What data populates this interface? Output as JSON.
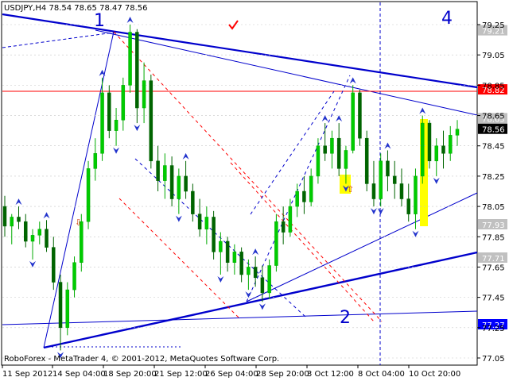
{
  "chart_data": {
    "type": "candlestick",
    "title": "USDJPY,H4  78.54 78.65 78.47 78.56",
    "footer": "RoboForex - MetaTrader 4, © 2001-2012, MetaQuotes Software Corp.",
    "y_ticks": [
      "79.25",
      "79.05",
      "78.85",
      "78.65",
      "78.45",
      "78.25",
      "78.05",
      "77.85",
      "77.65",
      "77.45",
      "77.25",
      "77.05"
    ],
    "x_ticks": [
      "11 Sep 2012",
      "14 Sep 04:00",
      "18 Sep 20:00",
      "21 Sep 12:00",
      "26 Sep 04:00",
      "28 Sep 20:00",
      "3 Oct 12:00",
      "8 Oct 04:00",
      "10 Oct 20:00"
    ],
    "ylim": [
      77.0,
      79.3
    ],
    "price_labels": [
      {
        "value": 79.21,
        "text": "79.21",
        "color": "#c0c0c0"
      },
      {
        "value": 78.82,
        "text": "78.82",
        "color": "#ff0000"
      },
      {
        "value": 78.63,
        "text": "78.63",
        "color": "#c0c0c0"
      },
      {
        "value": 78.56,
        "text": "78.56",
        "color": "#000000"
      },
      {
        "value": 77.93,
        "text": "77.93",
        "color": "#c0c0c0"
      },
      {
        "value": 77.71,
        "text": "77.71",
        "color": "#c0c0c0"
      },
      {
        "value": 77.27,
        "text": "77.27",
        "color": "#0000ff"
      }
    ],
    "wave_labels": [
      "1",
      "2",
      "4"
    ],
    "candles": [
      [
        78.05,
        78.12,
        77.85,
        77.92
      ],
      [
        77.92,
        78.0,
        77.8,
        77.98
      ],
      [
        77.98,
        78.05,
        77.9,
        77.95
      ],
      [
        77.95,
        78.0,
        77.78,
        77.82
      ],
      [
        77.82,
        77.9,
        77.7,
        77.86
      ],
      [
        77.86,
        77.95,
        77.8,
        77.9
      ],
      [
        77.9,
        77.96,
        77.75,
        77.78
      ],
      [
        77.78,
        77.85,
        77.5,
        77.55
      ],
      [
        77.55,
        77.6,
        77.1,
        77.25
      ],
      [
        77.25,
        77.55,
        77.2,
        77.5
      ],
      [
        77.5,
        77.72,
        77.45,
        77.68
      ],
      [
        77.68,
        78.0,
        77.62,
        77.95
      ],
      [
        77.95,
        78.35,
        77.9,
        78.3
      ],
      [
        78.3,
        78.5,
        78.22,
        78.4
      ],
      [
        78.4,
        78.9,
        78.35,
        78.8
      ],
      [
        78.8,
        78.85,
        78.5,
        78.55
      ],
      [
        78.55,
        78.7,
        78.45,
        78.62
      ],
      [
        78.62,
        78.9,
        78.55,
        78.85
      ],
      [
        78.85,
        79.25,
        78.8,
        79.2
      ],
      [
        79.2,
        79.22,
        78.6,
        78.7
      ],
      [
        78.7,
        79.0,
        78.6,
        78.88
      ],
      [
        78.88,
        78.92,
        78.3,
        78.35
      ],
      [
        78.35,
        78.45,
        78.15,
        78.22
      ],
      [
        78.22,
        78.4,
        78.1,
        78.32
      ],
      [
        78.32,
        78.38,
        78.05,
        78.1
      ],
      [
        78.1,
        78.3,
        78.0,
        78.25
      ],
      [
        78.25,
        78.35,
        78.1,
        78.15
      ],
      [
        78.15,
        78.2,
        77.95,
        78.0
      ],
      [
        78.0,
        78.1,
        77.85,
        77.9
      ],
      [
        77.9,
        78.05,
        77.8,
        77.98
      ],
      [
        77.98,
        78.02,
        77.7,
        77.75
      ],
      [
        77.75,
        77.88,
        77.6,
        77.82
      ],
      [
        77.82,
        77.85,
        77.62,
        77.68
      ],
      [
        77.68,
        77.8,
        77.6,
        77.75
      ],
      [
        77.75,
        77.78,
        77.55,
        77.6
      ],
      [
        77.6,
        77.7,
        77.5,
        77.65
      ],
      [
        77.65,
        77.72,
        77.52,
        77.58
      ],
      [
        77.58,
        77.66,
        77.42,
        77.48
      ],
      [
        77.48,
        77.7,
        77.44,
        77.66
      ],
      [
        77.66,
        78.0,
        77.62,
        77.95
      ],
      [
        77.95,
        78.05,
        77.8,
        77.88
      ],
      [
        77.88,
        78.1,
        77.85,
        78.05
      ],
      [
        78.05,
        78.2,
        77.98,
        78.15
      ],
      [
        78.15,
        78.25,
        78.0,
        78.08
      ],
      [
        78.08,
        78.3,
        78.05,
        78.25
      ],
      [
        78.25,
        78.5,
        78.2,
        78.45
      ],
      [
        78.45,
        78.6,
        78.35,
        78.4
      ],
      [
        78.4,
        78.55,
        78.3,
        78.5
      ],
      [
        78.5,
        78.6,
        78.25,
        78.3
      ],
      [
        78.3,
        78.45,
        78.2,
        78.42
      ],
      [
        78.42,
        78.85,
        78.4,
        78.8
      ],
      [
        78.8,
        78.82,
        78.45,
        78.5
      ],
      [
        78.5,
        78.55,
        78.15,
        78.2
      ],
      [
        78.2,
        78.35,
        78.05,
        78.1
      ],
      [
        78.1,
        78.4,
        78.05,
        78.35
      ],
      [
        78.35,
        78.42,
        78.15,
        78.25
      ],
      [
        78.25,
        78.35,
        78.1,
        78.2
      ],
      [
        78.2,
        78.3,
        78.05,
        78.1
      ],
      [
        78.1,
        78.2,
        77.95,
        78.0
      ],
      [
        78.0,
        78.3,
        77.9,
        78.25
      ],
      [
        78.25,
        78.65,
        78.2,
        78.6
      ],
      [
        78.6,
        78.62,
        78.3,
        78.35
      ],
      [
        78.35,
        78.5,
        78.25,
        78.45
      ],
      [
        78.45,
        78.55,
        78.3,
        78.4
      ],
      [
        78.4,
        78.58,
        78.35,
        78.52
      ],
      [
        78.52,
        78.62,
        78.45,
        78.56
      ]
    ]
  }
}
